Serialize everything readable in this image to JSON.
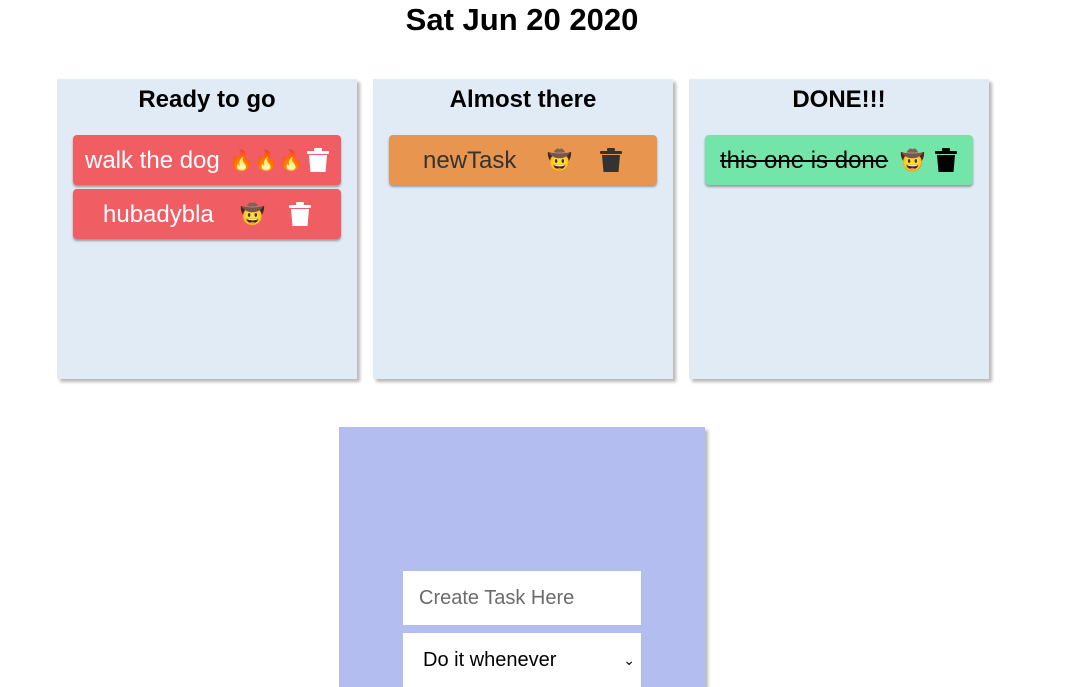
{
  "header": {
    "date": "Sat Jun 20 2020"
  },
  "columns": [
    {
      "title": "Ready to go",
      "tasks": [
        {
          "text": "walk the dog",
          "emoji": "🔥🔥🔥",
          "color": "#f05e64"
        },
        {
          "text": "hubadybla",
          "emoji": "🤠",
          "color": "#f05e64"
        }
      ]
    },
    {
      "title": "Almost there",
      "tasks": [
        {
          "text": "newTask",
          "emoji": "🤠",
          "color": "#e8954f"
        }
      ]
    },
    {
      "title": "DONE!!!",
      "tasks": [
        {
          "text": "this one is done",
          "emoji": "🤠",
          "color": "#74e5a9"
        }
      ]
    }
  ],
  "form": {
    "input_placeholder": "Create Task Here",
    "priority_selected": "Do it whenever"
  },
  "icons": {
    "task_delete": "trash-icon",
    "select_arrow": "chevron-down-icon"
  },
  "colors": {
    "column_bg": "#e0ebf6",
    "form_bg": "#b4bdef",
    "ready_task": "#f05e64",
    "almost_task": "#e8954f",
    "done_task": "#74e5a9"
  }
}
